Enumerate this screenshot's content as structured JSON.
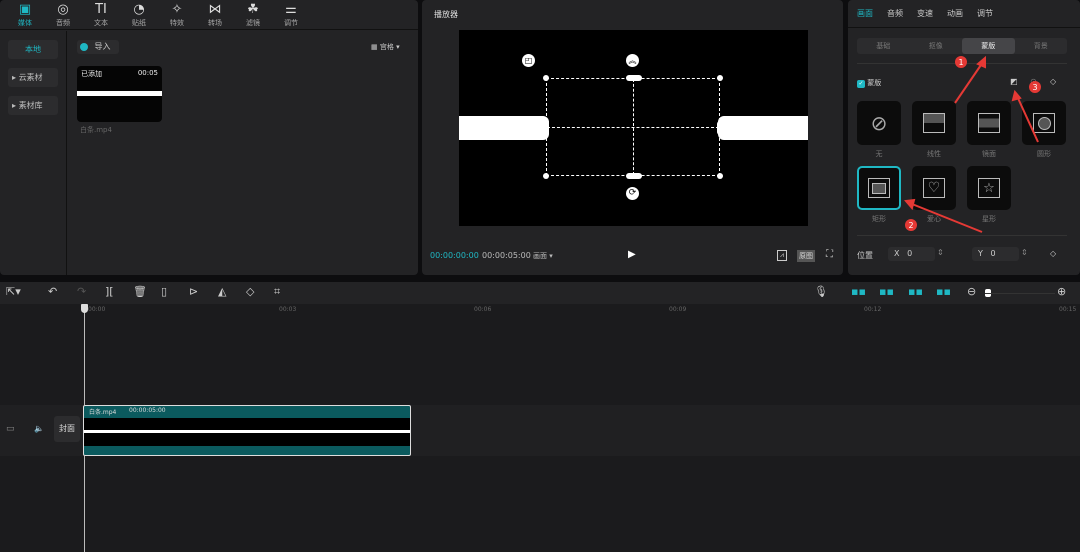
{
  "library": {
    "tabs": [
      {
        "label": "媒体",
        "icon": "media-icon"
      },
      {
        "label": "音频",
        "icon": "audio-icon"
      },
      {
        "label": "文本",
        "icon": "text-icon"
      },
      {
        "label": "贴纸",
        "icon": "sticker-icon"
      },
      {
        "label": "特效",
        "icon": "effects-icon"
      },
      {
        "label": "转场",
        "icon": "transition-icon"
      },
      {
        "label": "滤镜",
        "icon": "filter-icon"
      },
      {
        "label": "调节",
        "icon": "adjust-icon"
      }
    ],
    "side": [
      "本地",
      "云素材",
      "素材库"
    ],
    "import_label": "导入",
    "view_label": "宫格",
    "media": {
      "badge": "已添加",
      "duration": "00:05",
      "name": "白条.mp4"
    }
  },
  "player": {
    "title": "播放器",
    "current_time": "00:00:00:00",
    "total_time": "00:00:05:00",
    "ratio_label": "画面",
    "original_label": "原图"
  },
  "props": {
    "tabs": [
      "画面",
      "音频",
      "变速",
      "动画",
      "调节"
    ],
    "subtabs": [
      "基础",
      "抠像",
      "蒙版",
      "背景"
    ],
    "mask_label": "蒙版",
    "masks": [
      "无",
      "线性",
      "镜面",
      "圆形",
      "矩形",
      "爱心",
      "星形"
    ],
    "selected_mask": "矩形",
    "position_label": "位置",
    "x_label": "X",
    "x_value": "0",
    "y_label": "Y",
    "y_value": "0"
  },
  "annotations": [
    "1",
    "2",
    "3"
  ],
  "timeline": {
    "ticks": [
      "00:00",
      "00:03",
      "00:06",
      "00:09",
      "00:12",
      "00:15"
    ],
    "clip_name": "白条.mp4",
    "clip_duration": "00:00:05:00",
    "cover_label": "封面"
  },
  "colors": {
    "accent": "#1fb8c4",
    "annotation": "#e53935"
  }
}
